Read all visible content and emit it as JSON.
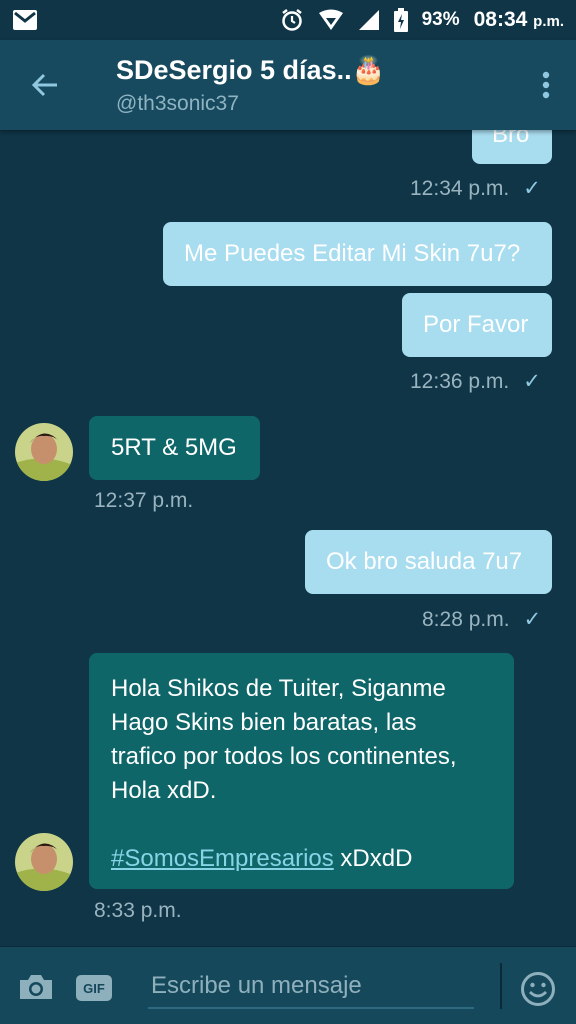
{
  "status_bar": {
    "battery": "93%",
    "time": "08:34",
    "ampm": "p.m."
  },
  "header": {
    "title": "SDeSergio 5 días..🎂",
    "handle": "@th3sonic37"
  },
  "messages": [
    {
      "direction": "out",
      "text": "Bro",
      "time": "12:34 p.m.",
      "check": "✓"
    },
    {
      "direction": "out",
      "text": "Me Puedes Editar Mi Skin 7u7?"
    },
    {
      "direction": "out",
      "text": "Por Favor",
      "time": "12:36 p.m.",
      "check": "✓"
    },
    {
      "direction": "in",
      "text": "5RT & 5MG",
      "time": "12:37 p.m."
    },
    {
      "direction": "out",
      "text": "Ok bro saluda 7u7",
      "time": "8:28 p.m.",
      "check": "✓"
    },
    {
      "direction": "in",
      "lines": [
        "Hola Shikos de Tuiter, Siganme",
        "Hago Skins bien baratas, las",
        "trafico por todos los continentes,",
        "Hola xdD."
      ],
      "hashtag": "#SomosEmpresarios",
      "suffix": " xDxdD",
      "time": "8:33 p.m."
    }
  ],
  "composer": {
    "placeholder": "Escribe un mensaje",
    "gif_label": "GIF"
  },
  "colors": {
    "background": "#0f3547",
    "header": "#174a5e",
    "outgoing_bubble": "#a8dcef",
    "incoming_bubble": "#0f6669"
  }
}
